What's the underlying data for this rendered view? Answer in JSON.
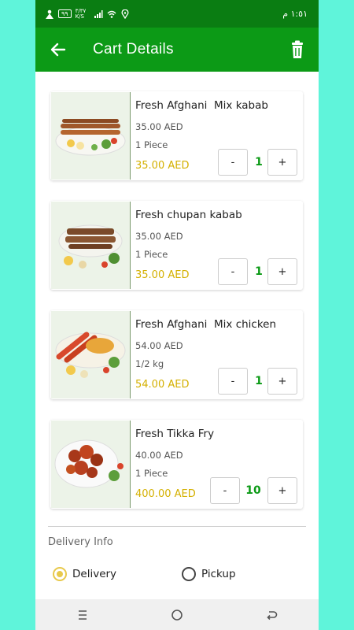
{
  "status_bar": {
    "time": "١:٥١ م",
    "battery_level": "٩٩",
    "network_speed": "٣/٣٧ K/S"
  },
  "app_bar": {
    "title": "Cart Details"
  },
  "cart_items": [
    {
      "name": "Fresh Afghani  Mix kabab",
      "price": "35.00 AED",
      "unit": "1 Piece",
      "total": "35.00 AED",
      "quantity": "1",
      "minus_label": "-",
      "plus_label": "+"
    },
    {
      "name": "Fresh chupan kabab",
      "price": "35.00 AED",
      "unit": "1 Piece",
      "total": "35.00 AED",
      "quantity": "1",
      "minus_label": "-",
      "plus_label": "+"
    },
    {
      "name": "Fresh Afghani  Mix chicken",
      "price": "54.00 AED",
      "unit": "1/2 kg",
      "total": "54.00 AED",
      "quantity": "1",
      "minus_label": "-",
      "plus_label": "+"
    },
    {
      "name": "Fresh Tikka Fry",
      "price": "40.00 AED",
      "unit": "1 Piece",
      "total": "400.00 AED",
      "quantity": "10",
      "minus_label": "-",
      "plus_label": "+"
    }
  ],
  "delivery_info": {
    "label": "Delivery Info",
    "options": [
      {
        "label": "Delivery",
        "selected": true
      },
      {
        "label": "Pickup",
        "selected": false
      }
    ]
  },
  "colors": {
    "status_bar": "#0a7d12",
    "app_bar": "#0c9a16",
    "price_highlight": "#d4b000",
    "quantity": "#0c9a16",
    "background": "#5ff4da"
  }
}
